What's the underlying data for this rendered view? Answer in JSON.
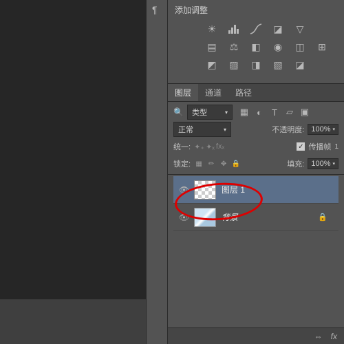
{
  "adjustments": {
    "title": "添加调整"
  },
  "tabs": {
    "layers": "图层",
    "channels": "通道",
    "paths": "路径"
  },
  "typeFilter": {
    "label": "类型"
  },
  "blend": {
    "mode": "正常",
    "opacityLabel": "不透明度:",
    "opacityValue": "100%"
  },
  "unify": {
    "label": "统一:",
    "propagateLabel": "传播帧"
  },
  "lock": {
    "label": "锁定:",
    "fillLabel": "填充:",
    "fillValue": "100%"
  },
  "layers": {
    "layer1": {
      "name": "图层 1"
    },
    "background": {
      "name": "背景"
    }
  }
}
